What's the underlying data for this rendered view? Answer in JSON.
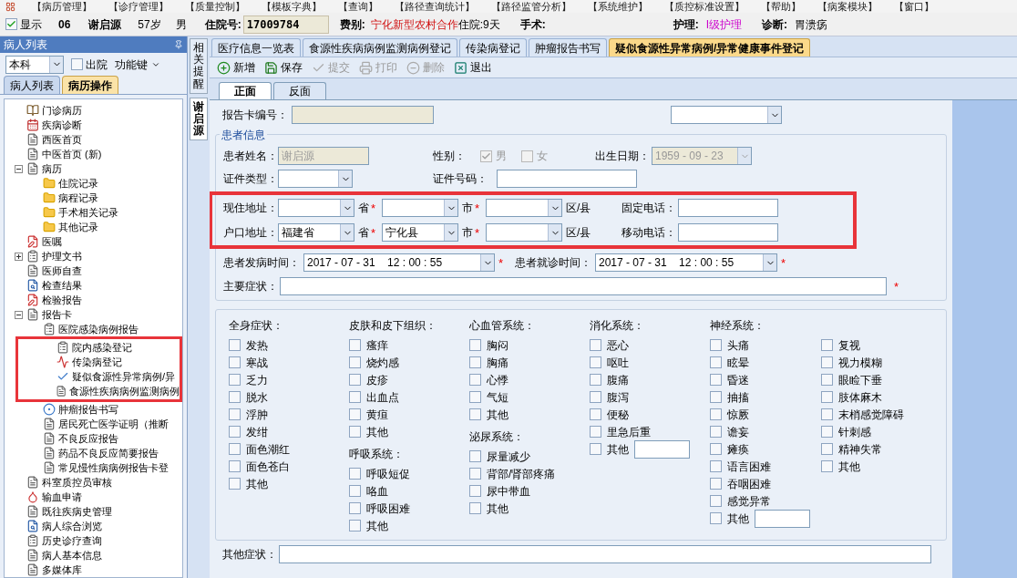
{
  "menu": [
    "【病历管理】",
    "【诊疗管理】",
    "【质量控制】",
    "【模板字典】",
    "【查询】",
    "【路径查询统计】",
    "【路径监管分析】",
    "【系统维护】",
    "【质控标准设置】",
    "【帮助】",
    "【病案模块】",
    "【窗口】"
  ],
  "patient_bar": {
    "show": {
      "label": "显示",
      "checked": true
    },
    "bed": "06",
    "name": "谢启源",
    "age": "57岁",
    "sex": "男",
    "admission_label": "住院号:",
    "admission_no": "17009784",
    "fee_label": "费别:",
    "fee_value": "宁化新型农村合作",
    "stay": "住院:9天",
    "surgery_label": "手术:",
    "nursing_label": "护理:",
    "nursing_value": "I级护理",
    "diagnosis_label": "诊断:",
    "diagnosis_value": "胃溃疡"
  },
  "left_panel": {
    "title": "病人列表",
    "dept": "本科",
    "discharged": {
      "label": "出院",
      "checked": false
    },
    "function_key": "功能键",
    "tabs": [
      {
        "label": "病人列表",
        "selected": false
      },
      {
        "label": "病历操作",
        "selected": true
      }
    ],
    "tree": [
      {
        "label": "门诊病历",
        "kind": "book"
      },
      {
        "label": "疾病诊断",
        "kind": "calendar"
      },
      {
        "label": "西医首页",
        "kind": "document"
      },
      {
        "label": "中医首页 (新)",
        "kind": "document"
      },
      {
        "label": "病历",
        "kind": "document",
        "expanded": true,
        "children": [
          {
            "label": "住院记录",
            "kind": "folder"
          },
          {
            "label": "病程记录",
            "kind": "folder"
          },
          {
            "label": "手术相关记录",
            "kind": "folder"
          },
          {
            "label": "其他记录",
            "kind": "folder"
          }
        ]
      },
      {
        "label": "医嘱",
        "kind": "pencil"
      },
      {
        "label": "护理文书",
        "kind": "checklist",
        "expanded": false
      },
      {
        "label": "医师自查",
        "kind": "document"
      },
      {
        "label": "检查结果",
        "kind": "magnifier"
      },
      {
        "label": "检验报告",
        "kind": "pencil"
      },
      {
        "label": "报告卡",
        "kind": "document",
        "expanded": true,
        "children": [
          {
            "label": "医院感染病例报告",
            "kind": "checklist"
          },
          {
            "label": "院内感染登记",
            "kind": "checklist",
            "marked": true
          },
          {
            "label": "传染病登记",
            "kind": "chart",
            "marked": true
          },
          {
            "label": "疑似食源性异常病例/异",
            "kind": "checkmark",
            "marked": true
          },
          {
            "label": "食源性疾病病例监测病例",
            "kind": "document",
            "marked": true
          },
          {
            "label": "肿瘤报告书写",
            "kind": "target"
          },
          {
            "label": "居民死亡医学证明（推断",
            "kind": "document"
          },
          {
            "label": "不良反应报告",
            "kind": "document"
          },
          {
            "label": "药品不良反应简要报告",
            "kind": "document"
          },
          {
            "label": "常见慢性病病例报告卡登",
            "kind": "document"
          }
        ]
      },
      {
        "label": "科室质控员审核",
        "kind": "document"
      },
      {
        "label": "输血申请",
        "kind": "blood"
      },
      {
        "label": "既往疾病史管理",
        "kind": "document"
      },
      {
        "label": "病人综合浏览",
        "kind": "magnifier"
      },
      {
        "label": "历史诊疗查询",
        "kind": "checklist"
      },
      {
        "label": "病人基本信息",
        "kind": "document"
      },
      {
        "label": "多媒体库",
        "kind": "document"
      }
    ]
  },
  "side_tabs": [
    {
      "label": "相关提醒",
      "selected": false
    },
    {
      "label": "谢启源",
      "selected": true
    }
  ],
  "doc_tabs": [
    {
      "label": "医疗信息一览表",
      "selected": false
    },
    {
      "label": "食源性疾病病例监测病例登记",
      "selected": false
    },
    {
      "label": "传染病登记",
      "selected": false
    },
    {
      "label": "肿瘤报告书写",
      "selected": false
    },
    {
      "label": "疑似食源性异常病例/异常健康事件登记",
      "selected": true
    }
  ],
  "toolbar": [
    {
      "label": "新增",
      "kind": "add",
      "disabled": false
    },
    {
      "label": "保存",
      "kind": "save",
      "disabled": false
    },
    {
      "label": "提交",
      "kind": "submit",
      "disabled": true
    },
    {
      "label": "打印",
      "kind": "print",
      "disabled": true
    },
    {
      "label": "删除",
      "kind": "delete",
      "disabled": true
    },
    {
      "label": "退出",
      "kind": "exit",
      "disabled": false
    }
  ],
  "sub_tabs": [
    {
      "label": "正面",
      "selected": true
    },
    {
      "label": "反面",
      "selected": false
    }
  ],
  "form": {
    "card_no": {
      "label": "报告卡编号：",
      "disabled": true
    },
    "patient_group": {
      "title": "患者信息",
      "name": {
        "label": "患者姓名：",
        "value": "谢启源",
        "disabled": true
      },
      "sex": {
        "label": "性别：",
        "disabled": true,
        "options": [
          {
            "label": "男",
            "checked": true
          },
          {
            "label": "女",
            "checked": false
          }
        ]
      },
      "birth": {
        "label": "出生日期：",
        "value": "1959 - 09 - 23",
        "disabled": true
      },
      "id_type": {
        "label": "证件类型："
      },
      "id_no": {
        "label": "证件号码："
      },
      "addresses": {
        "marked": true,
        "rows": [
          {
            "label": "现住地址：",
            "parts": [
              {
                "unit": "省",
                "required_mark": "*"
              },
              {
                "unit": "市",
                "required_mark": "*"
              },
              {
                "unit": "区/县"
              }
            ],
            "phone_label": "固定电话："
          },
          {
            "label": "户口地址：",
            "parts": [
              {
                "value": "福建省",
                "unit": "省",
                "required_mark": "*"
              },
              {
                "value": "宁化县",
                "unit": "市",
                "required_mark": "*"
              },
              {
                "unit": "区/县"
              }
            ],
            "phone_label": "移动电话："
          }
        ]
      },
      "onset": {
        "label": "患者发病时间：",
        "value": "2017 - 07 - 31    12 : 00 : 55",
        "required_mark": "*"
      },
      "visit": {
        "label": "患者就诊时间：",
        "value": "2017 - 07 - 31    12 : 00 : 55",
        "required_mark": "*"
      },
      "main_symptom": {
        "label": "主要症状：",
        "required_mark": "*"
      }
    },
    "symptoms": [
      [
        {
          "title": "全身症状：",
          "item_columns": [
            [
              {
                "label": "发热",
                "checked": false,
                "kind": "plain"
              },
              {
                "label": "寒战",
                "checked": false,
                "kind": "plain"
              },
              {
                "label": "乏力",
                "checked": false,
                "kind": "plain"
              },
              {
                "label": "脱水",
                "checked": false,
                "kind": "plain"
              },
              {
                "label": "浮肿",
                "checked": false,
                "kind": "plain"
              },
              {
                "label": "发绀",
                "checked": false,
                "kind": "plain"
              },
              {
                "label": "面色潮红",
                "checked": false,
                "kind": "plain"
              },
              {
                "label": "面色苍白",
                "checked": false,
                "kind": "plain"
              },
              {
                "label": "其他",
                "checked": false,
                "kind": "plain"
              }
            ]
          ]
        }
      ],
      [
        {
          "title": "皮肤和皮下组织：",
          "item_columns": [
            [
              {
                "label": "瘙痒",
                "checked": false,
                "kind": "plain"
              },
              {
                "label": "烧灼感",
                "checked": false,
                "kind": "plain"
              },
              {
                "label": "皮疹",
                "checked": false,
                "kind": "plain"
              },
              {
                "label": "出血点",
                "checked": false,
                "kind": "plain"
              },
              {
                "label": "黄疸",
                "checked": false,
                "kind": "plain"
              },
              {
                "label": "其他",
                "checked": false,
                "kind": "plain"
              }
            ]
          ]
        },
        {
          "title": "呼吸系统：",
          "item_columns": [
            [
              {
                "label": "呼吸短促",
                "checked": false,
                "kind": "plain"
              },
              {
                "label": "咯血",
                "checked": false,
                "kind": "plain"
              },
              {
                "label": "呼吸困难",
                "checked": false,
                "kind": "plain"
              },
              {
                "label": "其他",
                "checked": false,
                "kind": "plain"
              }
            ]
          ]
        }
      ],
      [
        {
          "title": "心血管系统：",
          "item_columns": [
            [
              {
                "label": "胸闷",
                "checked": false,
                "kind": "plain"
              },
              {
                "label": "胸痛",
                "checked": false,
                "kind": "plain"
              },
              {
                "label": "心悸",
                "checked": false,
                "kind": "plain"
              },
              {
                "label": "气短",
                "checked": false,
                "kind": "plain"
              },
              {
                "label": "其他",
                "checked": false,
                "kind": "plain"
              }
            ]
          ]
        },
        {
          "title": "泌尿系统：",
          "item_columns": [
            [
              {
                "label": "尿量减少",
                "checked": false,
                "kind": "plain"
              },
              {
                "label": "背部/肾部疼痛",
                "checked": false,
                "kind": "plain"
              },
              {
                "label": "尿中带血",
                "checked": false,
                "kind": "plain"
              },
              {
                "label": "其他",
                "checked": false,
                "kind": "plain"
              }
            ]
          ]
        }
      ],
      [
        {
          "title": "消化系统：",
          "item_columns": [
            [
              {
                "label": "恶心",
                "checked": false,
                "kind": "plain"
              },
              {
                "label": "呕吐",
                "checked": false,
                "kind": "plain"
              },
              {
                "label": "腹痛",
                "checked": false,
                "kind": "plain"
              },
              {
                "label": "腹泻",
                "checked": false,
                "kind": "plain"
              },
              {
                "label": "便秘",
                "checked": false,
                "kind": "plain"
              },
              {
                "label": "里急后重",
                "checked": false,
                "kind": "plain"
              },
              {
                "label": "其他",
                "checked": false,
                "kind": "with_field"
              }
            ]
          ]
        }
      ],
      [
        {
          "title": "神经系统：",
          "item_columns": [
            [
              {
                "label": "头痛",
                "checked": false,
                "kind": "plain"
              },
              {
                "label": "眩晕",
                "checked": false,
                "kind": "plain"
              },
              {
                "label": "昏迷",
                "checked": false,
                "kind": "plain"
              },
              {
                "label": "抽搐",
                "checked": false,
                "kind": "plain"
              },
              {
                "label": "惊厥",
                "checked": false,
                "kind": "plain"
              },
              {
                "label": "谵妄",
                "checked": false,
                "kind": "plain"
              },
              {
                "label": "瘫痪",
                "checked": false,
                "kind": "plain"
              },
              {
                "label": "语言困难",
                "checked": false,
                "kind": "plain"
              },
              {
                "label": "吞咽困难",
                "checked": false,
                "kind": "plain"
              },
              {
                "label": "感觉异常",
                "checked": false,
                "kind": "plain"
              },
              {
                "label": "其他",
                "checked": false,
                "kind": "with_field"
              }
            ],
            [
              {
                "label": "复视",
                "checked": false,
                "kind": "plain"
              },
              {
                "label": "视力模糊",
                "checked": false,
                "kind": "plain"
              },
              {
                "label": "眼睑下垂",
                "checked": false,
                "kind": "plain"
              },
              {
                "label": "肢体麻木",
                "checked": false,
                "kind": "plain"
              },
              {
                "label": "末梢感觉障碍",
                "checked": false,
                "kind": "plain"
              },
              {
                "label": "针刺感",
                "checked": false,
                "kind": "plain"
              },
              {
                "label": "精神失常",
                "checked": false,
                "kind": "plain"
              },
              {
                "label": "其他",
                "checked": false,
                "kind": "plain"
              }
            ]
          ]
        }
      ]
    ],
    "other_symptoms": {
      "label": "其他症状："
    }
  }
}
